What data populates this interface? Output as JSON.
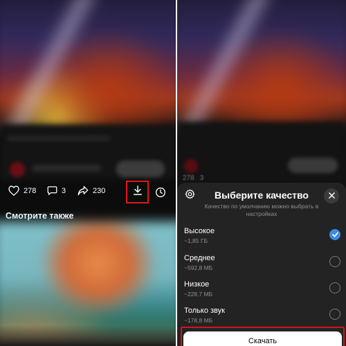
{
  "left": {
    "actions": {
      "likes": "278",
      "comments": "3",
      "shares": "230"
    },
    "see_also": "Смотрите также"
  },
  "right": {
    "dim_actions": {
      "likes": "278",
      "comments": "3"
    },
    "sheet": {
      "title": "Выберите качество",
      "subtitle": "Качество по умолчанию можно выбрать в настройках",
      "options": [
        {
          "label": "Высокое",
          "size": "~1,85 ГБ",
          "selected": true
        },
        {
          "label": "Среднее",
          "size": "~592,8 МБ",
          "selected": false
        },
        {
          "label": "Низкое",
          "size": "~228,7 МБ",
          "selected": false
        },
        {
          "label": "Только звук",
          "size": "~178,8 МБ",
          "selected": false
        }
      ],
      "download_label": "Скачать"
    }
  },
  "colors": {
    "accent": "#3f8ae0",
    "highlight": "#e4141a",
    "sheet_bg": "#232323"
  },
  "icons": [
    "heart-icon",
    "comment-icon",
    "share-icon",
    "download-icon",
    "clock-icon",
    "gear-icon",
    "close-icon",
    "check-icon"
  ]
}
